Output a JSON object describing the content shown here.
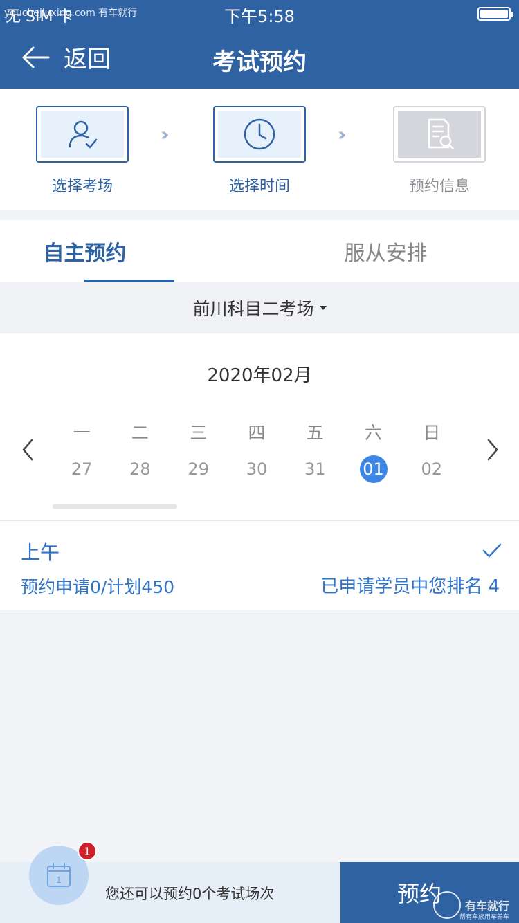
{
  "status_bar": {
    "carrier": "无 SIM 卡",
    "watermark": "youchejiuxing.com 有车就行",
    "time": "下午5:58"
  },
  "nav": {
    "back_label": "返回",
    "title": "考试预约"
  },
  "steps": [
    {
      "label": "选择考场",
      "state": "done",
      "icon": "user-check-icon"
    },
    {
      "label": "选择时间",
      "state": "current",
      "icon": "clock-icon"
    },
    {
      "label": "预约信息",
      "state": "pending",
      "icon": "document-search-icon"
    }
  ],
  "tabs": [
    {
      "label": "自主预约",
      "active": true
    },
    {
      "label": "服从安排",
      "active": false
    }
  ],
  "venue": {
    "name": "前川科目二考场"
  },
  "calendar": {
    "month": "2020年02月",
    "weekdays": [
      "一",
      "二",
      "三",
      "四",
      "五",
      "六",
      "日"
    ],
    "dates": [
      "27",
      "28",
      "29",
      "30",
      "31",
      "01",
      "02"
    ],
    "selected_index": 5
  },
  "slot": {
    "period": "上午",
    "quota": "预约申请0/计划450",
    "rank": "已申请学员中您排名 4",
    "checked": true
  },
  "bottom": {
    "badge_count": "1",
    "calendar_icon_day": "1",
    "remaining_text": "您还可以预约0个考试场次",
    "book_label": "预约",
    "brand_name": "有车就行",
    "brand_slogan": "帮有车族用车养车"
  },
  "colors": {
    "primary": "#2f62a3",
    "accent": "#3c86e6",
    "link": "#2f74c8",
    "badge": "#d0202a"
  }
}
